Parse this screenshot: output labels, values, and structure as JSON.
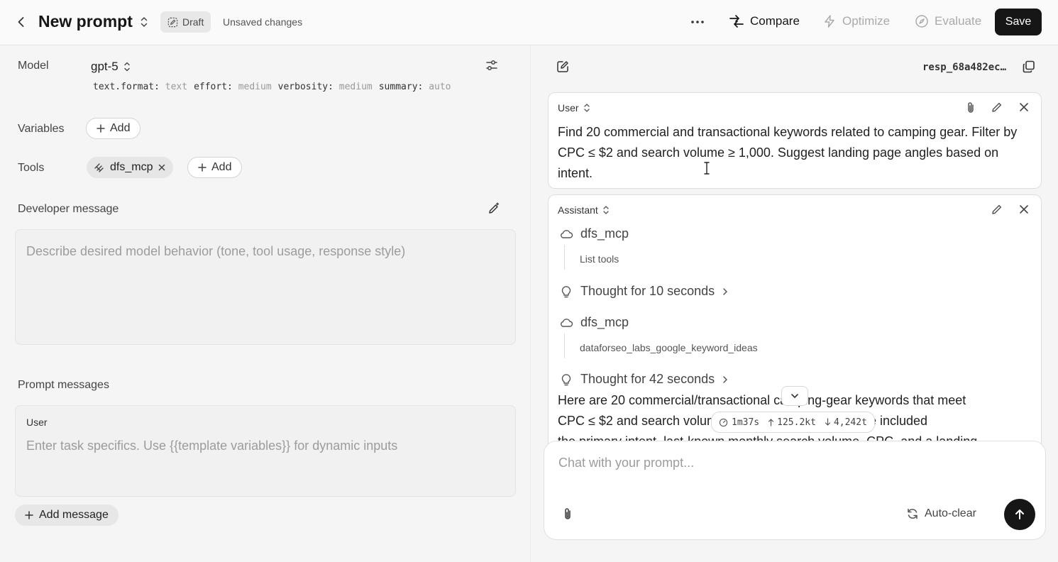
{
  "header": {
    "title": "New prompt",
    "draft_label": "Draft",
    "unsaved_label": "Unsaved changes",
    "compare_label": "Compare",
    "optimize_label": "Optimize",
    "evaluate_label": "Evaluate",
    "save_label": "Save"
  },
  "config": {
    "model_label": "Model",
    "model_value": "gpt-5",
    "params": [
      {
        "key": "text.format:",
        "value": "text"
      },
      {
        "key": "effort:",
        "value": "medium"
      },
      {
        "key": "verbosity:",
        "value": "medium"
      },
      {
        "key": "summary:",
        "value": "auto"
      }
    ],
    "variables_label": "Variables",
    "tools_label": "Tools",
    "add_label": "Add",
    "tool_chip": "dfs_mcp"
  },
  "developer": {
    "label": "Developer message",
    "placeholder": "Describe desired model behavior (tone, tool usage, response style)"
  },
  "prompt_messages": {
    "label": "Prompt messages",
    "role": "User",
    "placeholder": "Enter task specifics. Use {{template variables}} for dynamic inputs",
    "add_message_label": "Add message"
  },
  "response": {
    "id": "resp_68a482ec…",
    "user_role": "User",
    "user_text": "Find 20 commercial and transactional keywords related to camping gear. Filter by CPC ≤ $2 and search volume ≥ 1,000. Suggest landing page angles based on intent.",
    "assistant_role": "Assistant",
    "steps": {
      "tool1_name": "dfs_mcp",
      "tool1_sub": "List tools",
      "thought1": "Thought for 10 seconds",
      "tool2_name": "dfs_mcp",
      "tool2_sub": "dataforseo_labs_google_keyword_ideas",
      "thought2": "Thought for 42 seconds"
    },
    "answer_line1": "Here are 20 commercial/transactional camping-gear keywords that meet",
    "answer_line2": "CPC ≤ $2 and search volume ≥ 1,000 (US, English). I’ve included",
    "answer_line3": "the primary intent, last-known monthly search volume, CPC, and a landing",
    "stats": {
      "time": "1m37s",
      "up": "125.2kt",
      "down": "4,242t"
    }
  },
  "chat": {
    "placeholder": "Chat with your prompt...",
    "auto_clear_label": "Auto-clear"
  }
}
